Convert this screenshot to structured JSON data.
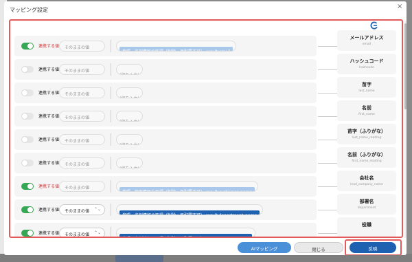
{
  "modal": {
    "title": "マッピング設定",
    "close_label": "×"
  },
  "icons": {
    "brand": "brand-logo-icon",
    "chevron": "chevron-updown-icon"
  },
  "colors": {
    "toggle_on": "#34a853",
    "highlight_frame": "#e35a5a",
    "chip_light": "#a8c7ea",
    "chip_dark": "#1e61b0",
    "ai_button": "#4a90d9"
  },
  "rows": [
    {
      "enabled": true,
      "label": "連携する値",
      "select": "そのままの値",
      "value": "参照　名刺情報の取得（削除・再配置不可）.result.email",
      "target_name": "メールアドレス",
      "target_key": "email"
    },
    {
      "enabled": false,
      "label": "連携する値",
      "select": "そのままの値",
      "value": "(値を入力)",
      "target_name": "ハッシュコード",
      "target_key": "hashcode"
    },
    {
      "enabled": false,
      "label": "連携する値",
      "select": "そのままの値",
      "value": "(値を入力)",
      "target_name": "苗字",
      "target_key": "last_name"
    },
    {
      "enabled": false,
      "label": "連携する値",
      "select": "そのままの値",
      "value": "(値を入力)",
      "target_name": "名前",
      "target_key": "first_name"
    },
    {
      "enabled": false,
      "label": "連携する値",
      "select": "そのままの値",
      "value": "(値を入力)",
      "target_name": "苗字（ふりがな）",
      "target_key": "last_name_reading"
    },
    {
      "enabled": false,
      "label": "連携する値",
      "select": "そのままの値",
      "value": "(値を入力)",
      "target_name": "名前（ふりがな）",
      "target_key": "first_name_reading"
    },
    {
      "enabled": true,
      "label": "連携する値",
      "select": "そのままの値",
      "value": "参照　顧客情報を取得（削除・再配置不可）.result.customer_name",
      "target_name": "会社名",
      "target_key": "lead_company_name"
    },
    {
      "enabled": true,
      "label": "連携する値",
      "select": "そのままの値",
      "value": "参照　名刺情報の取得（削除・再配置不可）.result.department_name",
      "target_name": "部署名",
      "target_key": "department"
    },
    {
      "enabled": true,
      "label": "連携する値",
      "select": "そのままの値",
      "value": "参照　名刺情報の取得（削除・再配置不可）.result.position_name",
      "target_name": "役職",
      "target_key": ""
    }
  ],
  "footer": {
    "ai_mapping_label": "AIマッピング",
    "close_label": "閉じる",
    "apply_label": "反映"
  }
}
